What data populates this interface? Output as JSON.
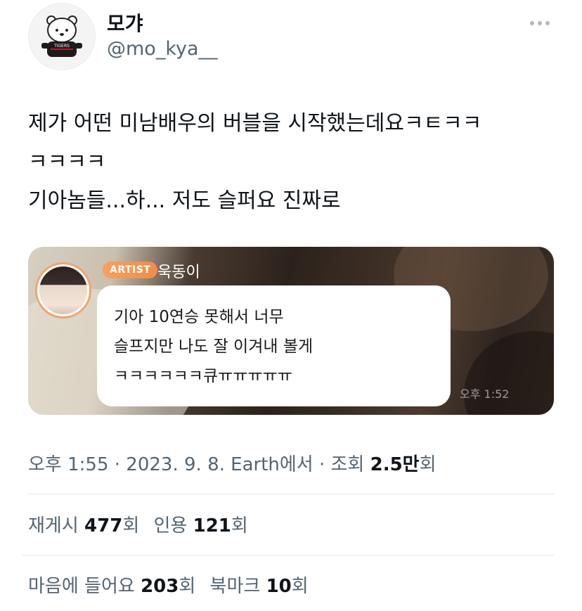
{
  "author": {
    "display_name": "모갸",
    "handle": "@mo_kya__",
    "avatar_text": "TIGERS"
  },
  "tweet": {
    "lines": [
      "제가 어떤 미남배우의 버블을 시작했는데요ㅋㅌㅋㅋ",
      "ㅋㅋㅋㅋ",
      "기아놈들...하... 저도 슬퍼요 진짜로"
    ]
  },
  "media": {
    "badge": "ARTIST",
    "artist_name": "욱동이",
    "message_lines": [
      "기아 10연승 못해서 너무",
      "슬프지만 나도 잘 이겨내 볼게",
      "ㅋㅋㅋㅋㅋㅋ큐ㅠㅠㅠㅠㅠ"
    ],
    "time": "오후 1:52"
  },
  "meta": {
    "time": "오후 1:55",
    "sep1": "·",
    "date": "2023. 9. 8.",
    "source": "Earth에서",
    "sep2": "·",
    "views_label": "조회",
    "views_value": "2.5만",
    "views_unit": "회"
  },
  "stats": {
    "retweets_label": "재게시",
    "retweets_value": "477",
    "retweets_unit": "회",
    "quotes_label": "인용",
    "quotes_value": "121",
    "quotes_unit": "회",
    "likes_label": "마음에 들어요",
    "likes_value": "203",
    "likes_unit": "회",
    "bookmarks_label": "북마크",
    "bookmarks_value": "10",
    "bookmarks_unit": "회"
  },
  "colors": {
    "text": "#0f1419",
    "secondary": "#536471",
    "badge": "#f18c4a"
  }
}
